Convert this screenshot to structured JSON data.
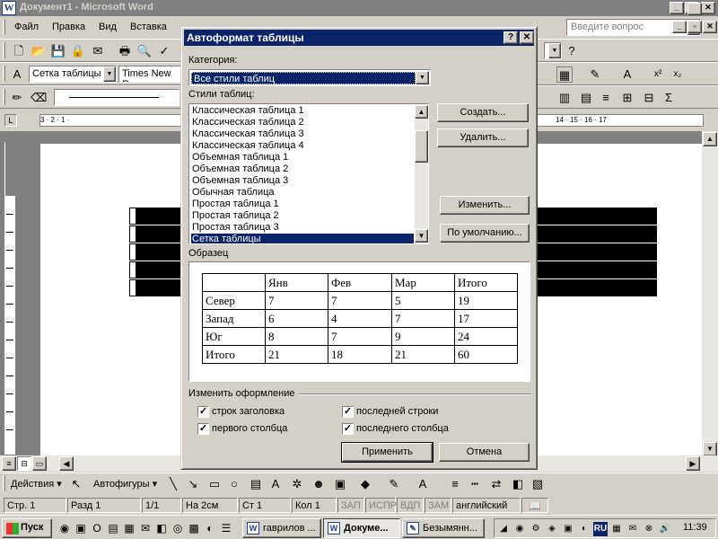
{
  "window": {
    "title": "Документ1 - Microsoft Word",
    "app_icon": "W"
  },
  "menu": {
    "items": [
      "Файл",
      "Правка",
      "Вид",
      "Вставка"
    ],
    "help_placeholder": "Введите вопрос"
  },
  "formatting": {
    "style": "Сетка таблицы",
    "font": "Times New Ro"
  },
  "ruler": {
    "left_marks": "3 · 2 · 1 · ",
    "right_marks": "14 · 15 · 16 · 17"
  },
  "dialog": {
    "title": "Автоформат таблицы",
    "category_label": "Категория:",
    "category_value": "Все стили таблиц",
    "styles_label": "Стили таблиц:",
    "styles": [
      "Классическая таблица 1",
      "Классическая таблица 2",
      "Классическая таблица 3",
      "Классическая таблица 4",
      "Объемная таблица 1",
      "Объемная таблица 2",
      "Объемная таблица 3",
      "Обычная таблица",
      "Простая таблица 1",
      "Простая таблица 2",
      "Простая таблица 3",
      "Сетка таблицы"
    ],
    "selected_style": "Сетка таблицы",
    "buttons": {
      "create": "Создать...",
      "delete": "Удалить...",
      "modify": "Изменить...",
      "default": "По умолчанию...",
      "apply": "Применить",
      "cancel": "Отмена"
    },
    "preview_label": "Образец",
    "preview_table": {
      "header": [
        "",
        "Янв",
        "Фев",
        "Мар",
        "Итого"
      ],
      "rows": [
        [
          "Север",
          "7",
          "7",
          "5",
          "19"
        ],
        [
          "Запад",
          "6",
          "4",
          "7",
          "17"
        ],
        [
          "Юг",
          "8",
          "7",
          "9",
          "24"
        ],
        [
          "Итого",
          "21",
          "18",
          "21",
          "60"
        ]
      ]
    },
    "change_label": "Изменить оформление",
    "checkboxes": {
      "header_rows": {
        "label": "строк заголовка",
        "checked": true
      },
      "first_column": {
        "label": "первого столбца",
        "checked": true
      },
      "last_row": {
        "label": "последней строки",
        "checked": true
      },
      "last_column": {
        "label": "последнего столбца",
        "checked": true
      }
    }
  },
  "drawing": {
    "actions": "Действия ▾",
    "autoshapes": "Автофигуры ▾"
  },
  "status": {
    "page": "Стр. 1",
    "section": "Разд 1",
    "pages": "1/1",
    "at": "На 2см",
    "line": "Ст 1",
    "col": "Кол 1",
    "rec": "ЗАП",
    "trk": "ИСПР",
    "ext": "ВДП",
    "ovr": "ЗАМ",
    "language": "английский"
  },
  "taskbar": {
    "start": "Пуск",
    "tasks": [
      "гаврилов ...",
      "Докуме...",
      "Безымянн..."
    ],
    "clock": "11:39",
    "lang": "RU"
  }
}
